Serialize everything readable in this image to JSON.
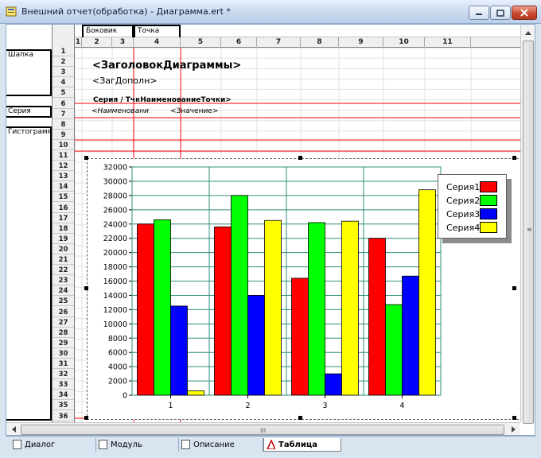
{
  "window": {
    "title": "Внешний отчет(обработка) - Диаграмма.ert *"
  },
  "sections": [
    {
      "label": "Шапка",
      "top": 31,
      "height": 59
    },
    {
      "label": "Серия",
      "top": 102,
      "height": 15
    },
    {
      "label": "Гистограмма",
      "top": 128,
      "height": 370
    }
  ],
  "column_sections": [
    {
      "label": "Боковик",
      "col": 2
    },
    {
      "label": "Точка",
      "col": 4
    }
  ],
  "rows": [
    "1",
    "2",
    "3",
    "4",
    "5",
    "6",
    "7",
    "8",
    "9",
    "10",
    "11",
    "12",
    "13",
    "14",
    "15",
    "16",
    "17",
    "18",
    "19",
    "20",
    "21",
    "22",
    "23",
    "24",
    "25",
    "26",
    "27",
    "28",
    "29",
    "30",
    "31",
    "32",
    "33",
    "34",
    "35",
    "36"
  ],
  "columns": [
    "1",
    "2",
    "3",
    "4",
    "5",
    "6",
    "7",
    "8",
    "9",
    "10",
    "11"
  ],
  "header": {
    "title": "<ЗаголовокДиаграммы>",
    "subtitle": "<ЗагДополн>",
    "series_header": "Серия / ТчкНаименованиеТочки>",
    "name_placeholder": "<Наименовани",
    "value_placeholder": "<Значение>"
  },
  "chart_data": {
    "type": "bar",
    "categories": [
      "1",
      "2",
      "3",
      "4"
    ],
    "series": [
      {
        "name": "Серия1",
        "color": "#ff0000",
        "values": [
          24000,
          23600,
          16400,
          22000
        ]
      },
      {
        "name": "Серия2",
        "color": "#00ff00",
        "values": [
          24600,
          28000,
          24200,
          12700
        ]
      },
      {
        "name": "Серия3",
        "color": "#0000ff",
        "values": [
          12500,
          14000,
          3000,
          16700
        ]
      },
      {
        "name": "Серия4",
        "color": "#ffff00",
        "values": [
          600,
          24500,
          24400,
          28800
        ]
      }
    ],
    "ylim": [
      0,
      32000
    ],
    "yticks": [
      "0",
      "2000",
      "4000",
      "6000",
      "8000",
      "10000",
      "12000",
      "14000",
      "16000",
      "18000",
      "20000",
      "22000",
      "24000",
      "26000",
      "28000",
      "30000",
      "32000"
    ],
    "grid": true,
    "legend_position": "right"
  },
  "tabs": [
    {
      "label": "Диалог",
      "active": false
    },
    {
      "label": "Модуль",
      "active": false
    },
    {
      "label": "Описание",
      "active": false
    },
    {
      "label": "Таблица",
      "active": true
    }
  ],
  "scroll": {
    "grip": "III"
  }
}
